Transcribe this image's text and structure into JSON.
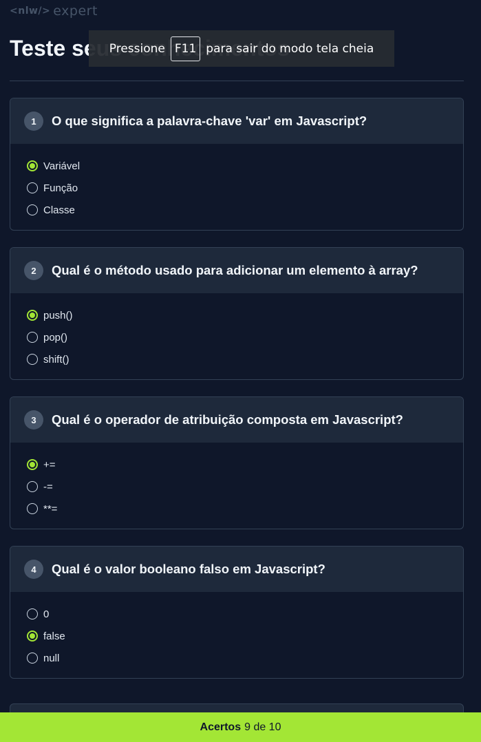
{
  "logo": {
    "tag": "<nlw/>",
    "name": "expert"
  },
  "page_title": "Teste seus conhecimentos",
  "fullscreen_banner": {
    "prefix": "Pressione",
    "key": "F11",
    "suffix": "para sair do modo tela cheia"
  },
  "questions": [
    {
      "number": "1",
      "text": "O que significa a palavra-chave 'var' em Javascript?",
      "options": [
        {
          "label": "Variável",
          "checked": true
        },
        {
          "label": "Função",
          "checked": false
        },
        {
          "label": "Classe",
          "checked": false
        }
      ]
    },
    {
      "number": "2",
      "text": "Qual é o método usado para adicionar um elemento à array?",
      "options": [
        {
          "label": "push()",
          "checked": true
        },
        {
          "label": "pop()",
          "checked": false
        },
        {
          "label": "shift()",
          "checked": false
        }
      ]
    },
    {
      "number": "3",
      "text": "Qual é o operador de atribuição composta em Javascript?",
      "options": [
        {
          "label": "+=",
          "checked": true
        },
        {
          "label": "-=",
          "checked": false
        },
        {
          "label": "**=",
          "checked": false
        }
      ]
    },
    {
      "number": "4",
      "text": "Qual é o valor booleano falso em Javascript?",
      "options": [
        {
          "label": "0",
          "checked": false
        },
        {
          "label": "false",
          "checked": true
        },
        {
          "label": "null",
          "checked": false
        }
      ]
    }
  ],
  "footer": {
    "label": "Acertos",
    "score": "9 de 10"
  },
  "colors": {
    "background": "#0f172a",
    "card_header": "#1e293b",
    "accent": "#a3e635"
  }
}
